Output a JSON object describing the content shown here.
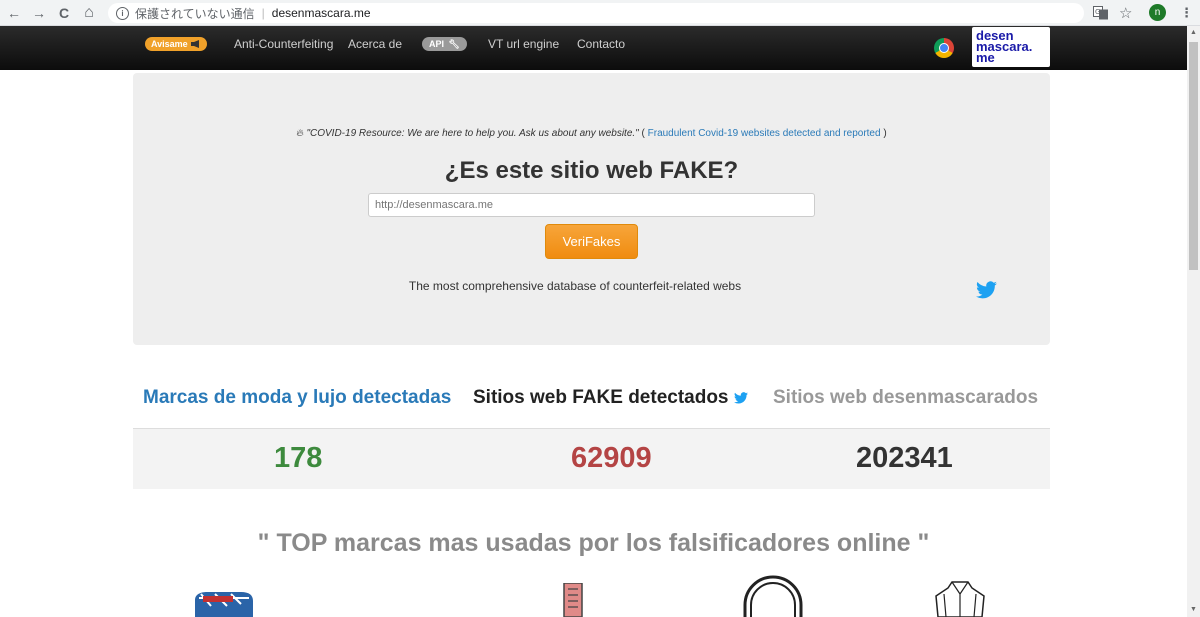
{
  "browser": {
    "nav": {
      "back": "←",
      "forward": "→",
      "reload": "C",
      "home": "⌂"
    },
    "security_text": "保護されていない通信",
    "url": "desenmascara.me",
    "avatar_letter": "n"
  },
  "navbar": {
    "avisame": "Avisame",
    "items": [
      "Anti-Counterfeiting",
      "Acerca de",
      "API",
      "VT url engine",
      "Contacto"
    ]
  },
  "logo": {
    "line1": "desen",
    "line2": "mascara.",
    "line3": "me"
  },
  "hero": {
    "covid_quote": "\"COVID-19 Resource: We are here to help you. Ask us about any website.\"",
    "covid_paren_open": "(",
    "covid_link": "Fraudulent Covid-19 websites detected and reported",
    "covid_paren_close": ")",
    "title": "¿Es este sitio web FAKE?",
    "input_placeholder": "http://desenmascara.me",
    "button": "VeriFakes",
    "tagline": "The most comprehensive database of counterfeit-related webs"
  },
  "stats": [
    {
      "label": "Marcas de moda y lujo detectadas",
      "value": "178",
      "label_color": "#2a7ab8",
      "value_color": "#3d8a3d"
    },
    {
      "label": "Sitios web FAKE detectados",
      "value": "62909",
      "label_color": "#222222",
      "value_color": "#b44444"
    },
    {
      "label": "Sitios web desenmascarados",
      "value": "202341",
      "label_color": "#999999",
      "value_color": "#333333"
    }
  ],
  "top_title": "\" TOP marcas mas usadas por los falsificadores online \"",
  "brand_icons": [
    "sneaker-icon",
    "boot-icon",
    "headphones-icon",
    "jacket-icon"
  ]
}
